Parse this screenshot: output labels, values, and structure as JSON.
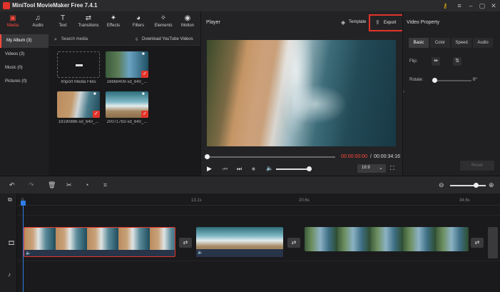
{
  "app": {
    "title": "MiniTool MovieMaker Free 7.4.1"
  },
  "toolbar": {
    "tabs": [
      {
        "label": "Media",
        "icon": "media-icon"
      },
      {
        "label": "Audio",
        "icon": "music-note-icon"
      },
      {
        "label": "Text",
        "icon": "text-icon"
      },
      {
        "label": "Transitions",
        "icon": "transitions-icon"
      },
      {
        "label": "Effects",
        "icon": "effects-icon"
      },
      {
        "label": "Filters",
        "icon": "filters-icon"
      },
      {
        "label": "Elements",
        "icon": "elements-icon"
      },
      {
        "label": "Motion",
        "icon": "motion-icon"
      }
    ]
  },
  "sidebar": {
    "items": [
      {
        "label": "My Album (3)"
      },
      {
        "label": "Videos (3)"
      },
      {
        "label": "Music (0)"
      },
      {
        "label": "Pictures (0)"
      }
    ]
  },
  "media": {
    "search_placeholder": "Search media",
    "download_label": "Download YouTube Videos",
    "import_label": "Import Media Files",
    "items": [
      {
        "name": "16668409-sd_640_..."
      },
      {
        "name": "19190886-sd_640_..."
      },
      {
        "name": "20071783-sd_640_..."
      }
    ]
  },
  "player": {
    "title": "Player",
    "template_label": "Template",
    "export_label": "Export",
    "current_time": "00:00:00:00",
    "separator": "/",
    "total_time": "00:00:34:16",
    "aspect": "16:9"
  },
  "properties": {
    "title": "Video Property",
    "tabs": [
      "Basic",
      "Color",
      "Speed",
      "Audio"
    ],
    "flip_label": "Flip:",
    "rotate_label": "Rotate:",
    "rotate_value": "0°",
    "reset_label": "Reset"
  },
  "timeline": {
    "ruler": [
      "0",
      "13.1s",
      "20.6s",
      "34.6s"
    ]
  },
  "colors": {
    "accent": "#ff4a3d",
    "highlight_border": "#e2342b"
  }
}
